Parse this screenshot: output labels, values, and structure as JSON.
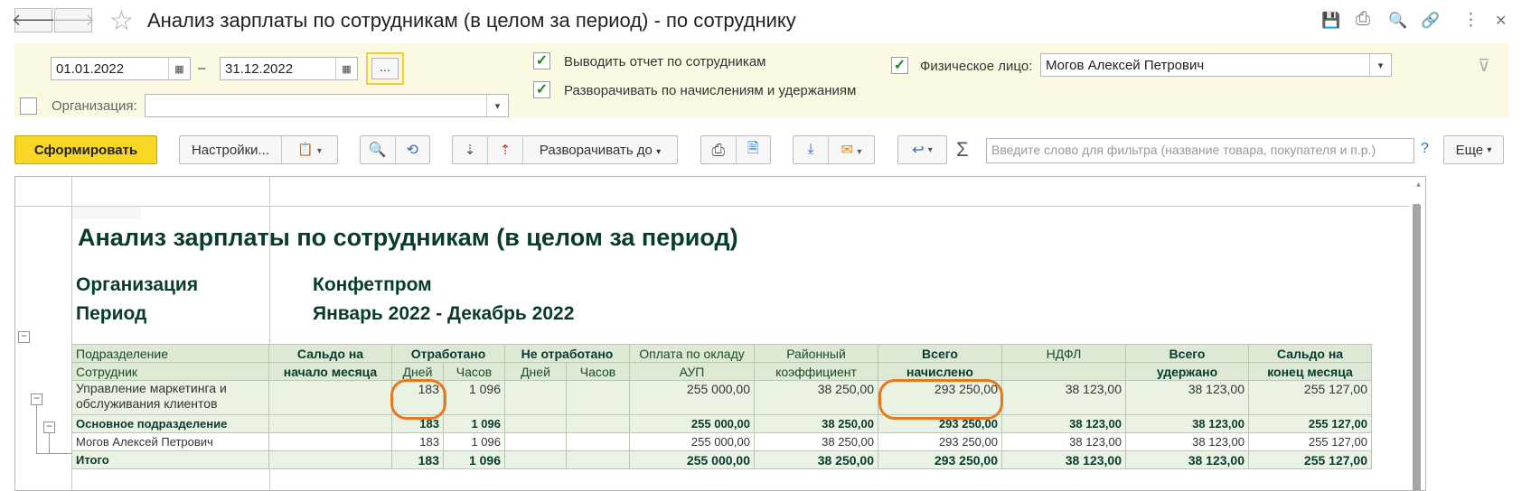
{
  "window": {
    "title": "Анализ зарплаты по сотрудникам (в целом за период) - по сотруднику",
    "back_icon": "arrow-left-icon",
    "forward_icon": "arrow-right-icon",
    "favorite_icon": "star-icon",
    "icons": [
      "save-icon",
      "print-icon",
      "preview-icon",
      "link-icon",
      "more-icon",
      "close-icon"
    ],
    "back_glyph": "🡐",
    "forward_glyph": "🡒",
    "star_glyph": "☆",
    "save_glyph": "💾",
    "print_glyph": "⎙",
    "preview_glyph": "🔍",
    "link_glyph": "🔗",
    "more_glyph": "⋮",
    "close_glyph": "✕"
  },
  "params": {
    "date_from": "01.01.2022",
    "date_dash": "–",
    "date_to": "31.12.2022",
    "period_button": "...",
    "show_by_employees_label": "Выводить отчет по сотрудникам",
    "expand_accruals_label": "Разворачивать по начислениям и удержаниям",
    "person_label": "Физическое лицо:",
    "person_value": "Могов Алексей Петрович",
    "organization_label": "Организация:",
    "organization_value": "",
    "checkmark": "✓",
    "calendar_glyph": "▦",
    "dropdown_glyph": "▾",
    "filter_glyph": "⊽"
  },
  "toolbar": {
    "generate_label": "Сформировать",
    "settings_label": "Настройки...",
    "expand_to_label": "Разворачивать до",
    "filter_placeholder": "Введите слово для фильтра (название товара, покупателя и п.р.)",
    "help_label": "?",
    "more_label": "Еще",
    "sigma": "Σ",
    "variants_glyph": "📋",
    "search_glyph": "🔍",
    "search_repeat_glyph": "⟲",
    "sort_desc_glyph": "⇣",
    "sort_asc_glyph": "⇡",
    "print_glyph": "⎙",
    "preview_glyph": "🗎",
    "download_glyph": "⤓",
    "mail_glyph": "✉",
    "undo_glyph": "↩"
  },
  "report": {
    "title": "Анализ зарплаты по сотрудникам (в целом за период)",
    "org_label": "Организация",
    "org_value": "Конфетпром",
    "period_label": "Период",
    "period_value": "Январь 2022 - Декабрь 2022",
    "headers": {
      "department": "Подразделение",
      "employee": "Сотрудник",
      "opening_balance_1": "Сальдо на",
      "opening_balance_2": "начало месяца",
      "worked": "Отработано",
      "not_worked": "Не отработано",
      "days": "Дней",
      "hours": "Часов",
      "salary_1": "Оплата по окладу",
      "salary_2": "АУП",
      "regional_1": "Районный",
      "regional_2": "коэффициент",
      "total_accrued_1": "Всего",
      "total_accrued_2": "начислено",
      "ndfl": "НДФЛ",
      "total_withheld_1": "Всего",
      "total_withheld_2": "удержано",
      "closing_balance_1": "Сальдо на",
      "closing_balance_2": "конец месяца"
    },
    "rows": [
      {
        "name_1": "Управление маркетинга и",
        "name_2": "обслуживания клиентов",
        "opening": "",
        "days": "183",
        "hours": "1 096",
        "nw_days": "",
        "nw_hours": "",
        "salary": "255 000,00",
        "regional": "38 250,00",
        "accrued": "293 250,00",
        "ndfl": "38 123,00",
        "withheld": "38 123,00",
        "closing": "255 127,00"
      },
      {
        "name": "Основное подразделение",
        "opening": "",
        "days": "183",
        "hours": "1 096",
        "nw_days": "",
        "nw_hours": "",
        "salary": "255 000,00",
        "regional": "38 250,00",
        "accrued": "293 250,00",
        "ndfl": "38 123,00",
        "withheld": "38 123,00",
        "closing": "255 127,00"
      },
      {
        "name": "Могов Алексей Петрович",
        "opening": "",
        "days": "183",
        "hours": "1 096",
        "nw_days": "",
        "nw_hours": "",
        "salary": "255 000,00",
        "regional": "38 250,00",
        "accrued": "293 250,00",
        "ndfl": "38 123,00",
        "withheld": "38 123,00",
        "closing": "255 127,00"
      },
      {
        "name": "Итого",
        "opening": "",
        "days": "183",
        "hours": "1 096",
        "nw_days": "",
        "nw_hours": "",
        "salary": "255 000,00",
        "regional": "38 250,00",
        "accrued": "293 250,00",
        "ndfl": "38 123,00",
        "withheld": "38 123,00",
        "closing": "255 127,00"
      }
    ],
    "tree_minus": "−",
    "scroll_up": "▴"
  },
  "colors": {
    "params_bg": "#fcf9e3",
    "primary_button": "#f9d727",
    "header_bg": "#dde9d5",
    "row_bg": "#eaf2e4",
    "highlight": "#e8781c",
    "title_text": "#073b2e"
  }
}
